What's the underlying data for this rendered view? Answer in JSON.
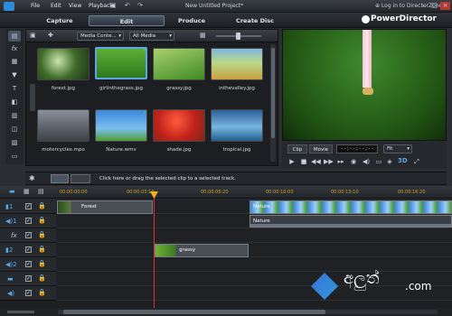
{
  "app": {
    "title": "New Untitled Project*",
    "brand": "PowerDirector"
  },
  "menu": [
    "File",
    "Edit",
    "View",
    "Playback"
  ],
  "modes": [
    {
      "label": "Capture"
    },
    {
      "label": "Edit"
    },
    {
      "label": "Produce"
    },
    {
      "label": "Create Disc"
    }
  ],
  "library": {
    "filter_content": "Media Conte...",
    "filter_type": "All Media",
    "items": [
      {
        "name": "forest.jpg"
      },
      {
        "name": "girlinthegrass.jpg"
      },
      {
        "name": "grassy.jpg"
      },
      {
        "name": "inthevalley.jpg"
      },
      {
        "name": "motorcycles.mpo"
      },
      {
        "name": "Nature.wmv"
      },
      {
        "name": "shade.jpg"
      },
      {
        "name": "tropical.jpg"
      }
    ]
  },
  "preview": {
    "tab_clip": "Clip",
    "tab_movie": "Movie",
    "timecode": "- - ; - - ; - - ; - -",
    "fit": "Fit",
    "three_d": "3D"
  },
  "hint": "Click here or drag the selected clip to a selected track.",
  "timeline": {
    "ticks": [
      "00:00:00:00",
      "00:00:03:10",
      "00:00:06:20",
      "00:00:10:00",
      "00:00:13:10",
      "00:00:16:20"
    ],
    "clips": {
      "forest": "Forest",
      "nature": "Nature",
      "nature_audio": "Nature",
      "grassy": "grassy"
    }
  },
  "watermark": {
    "text": "අලුත්",
    "domain": ".com"
  },
  "colors": {
    "accent": "#5aa7e8",
    "playhead": "#e03030",
    "ruler": "#c8a030"
  }
}
